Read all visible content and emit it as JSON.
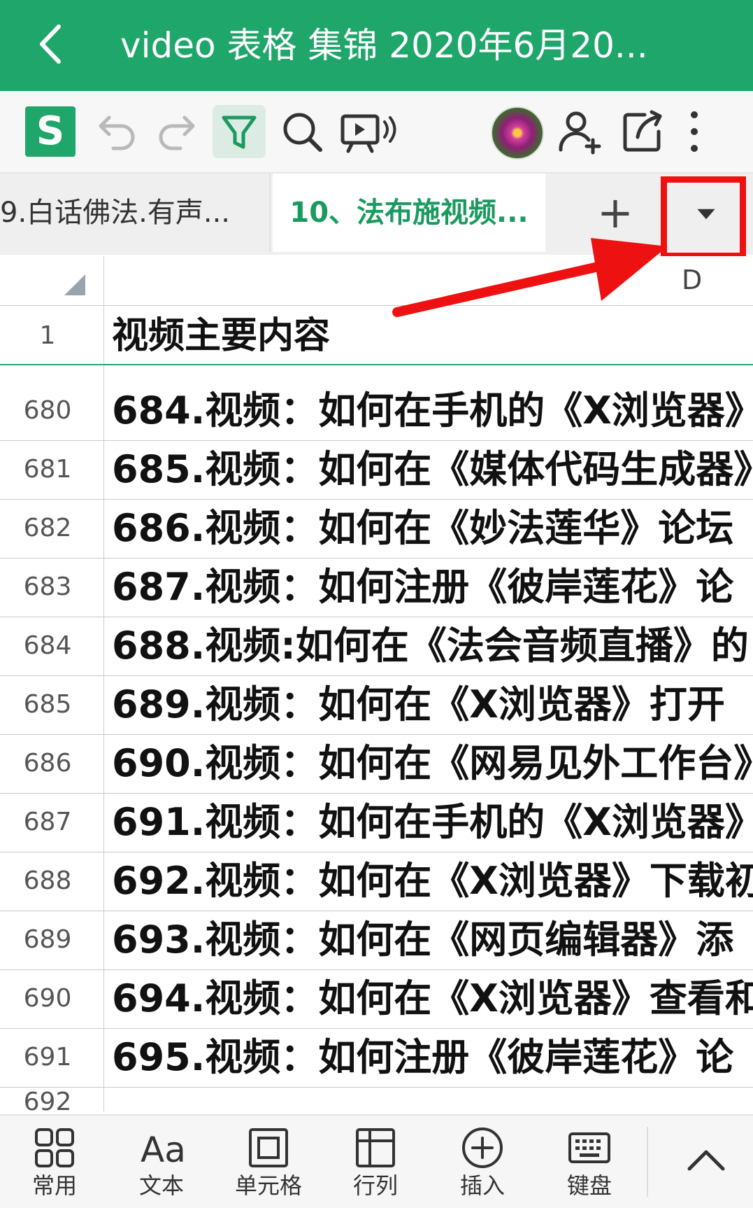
{
  "titlebar": {
    "title": "video 表格 集锦 2020年6月20..."
  },
  "icons": {
    "back": "chevron-left-icon",
    "undo": "undo-icon",
    "redo": "redo-icon",
    "filter": "filter-icon",
    "search": "search-icon",
    "present": "presentation-icon",
    "add_user": "add-user-icon",
    "share": "share-icon",
    "more": "more-vertical-icon"
  },
  "tabs": {
    "items": [
      {
        "label": "9.白话佛法.有声..."
      },
      {
        "label": "10、法布施视频..."
      }
    ],
    "add_label": "+"
  },
  "grid": {
    "column_label": "D",
    "header_row": {
      "num": "1",
      "text": "视频主要内容"
    },
    "rows": [
      {
        "num": "680",
        "text": "684.视频：如何在手机的《X浏览器》"
      },
      {
        "num": "681",
        "text": "685.视频：如何在《媒体代码生成器》"
      },
      {
        "num": "682",
        "text": "686.视频：如何在《妙法莲华》论坛"
      },
      {
        "num": "683",
        "text": "687.视频：如何注册《彼岸莲花》论"
      },
      {
        "num": "684",
        "text": "688.视频:如何在《法会音频直播》的"
      },
      {
        "num": "685",
        "text": "689.视频：如何在《X浏览器》打开"
      },
      {
        "num": "686",
        "text": "690.视频：如何在《网易见外工作台》"
      },
      {
        "num": "687",
        "text": "691.视频：如何在手机的《X浏览器》"
      },
      {
        "num": "688",
        "text": "692.视频：如何在《X浏览器》下载初"
      },
      {
        "num": "689",
        "text": "693.视频：如何在《网页编辑器》添"
      },
      {
        "num": "690",
        "text": "694.视频：如何在《X浏览器》查看和"
      },
      {
        "num": "691",
        "text": "695.视频：如何注册《彼岸莲花》论"
      }
    ],
    "partial_row_num": "692"
  },
  "bottombar": {
    "items": [
      {
        "label": "常用"
      },
      {
        "label": "文本"
      },
      {
        "label": "单元格"
      },
      {
        "label": "行列"
      },
      {
        "label": "插入"
      },
      {
        "label": "键盘"
      }
    ]
  },
  "colors": {
    "brand": "#1fa66a",
    "tab_active": "#1b9a60",
    "annotation": "#ee1111"
  }
}
